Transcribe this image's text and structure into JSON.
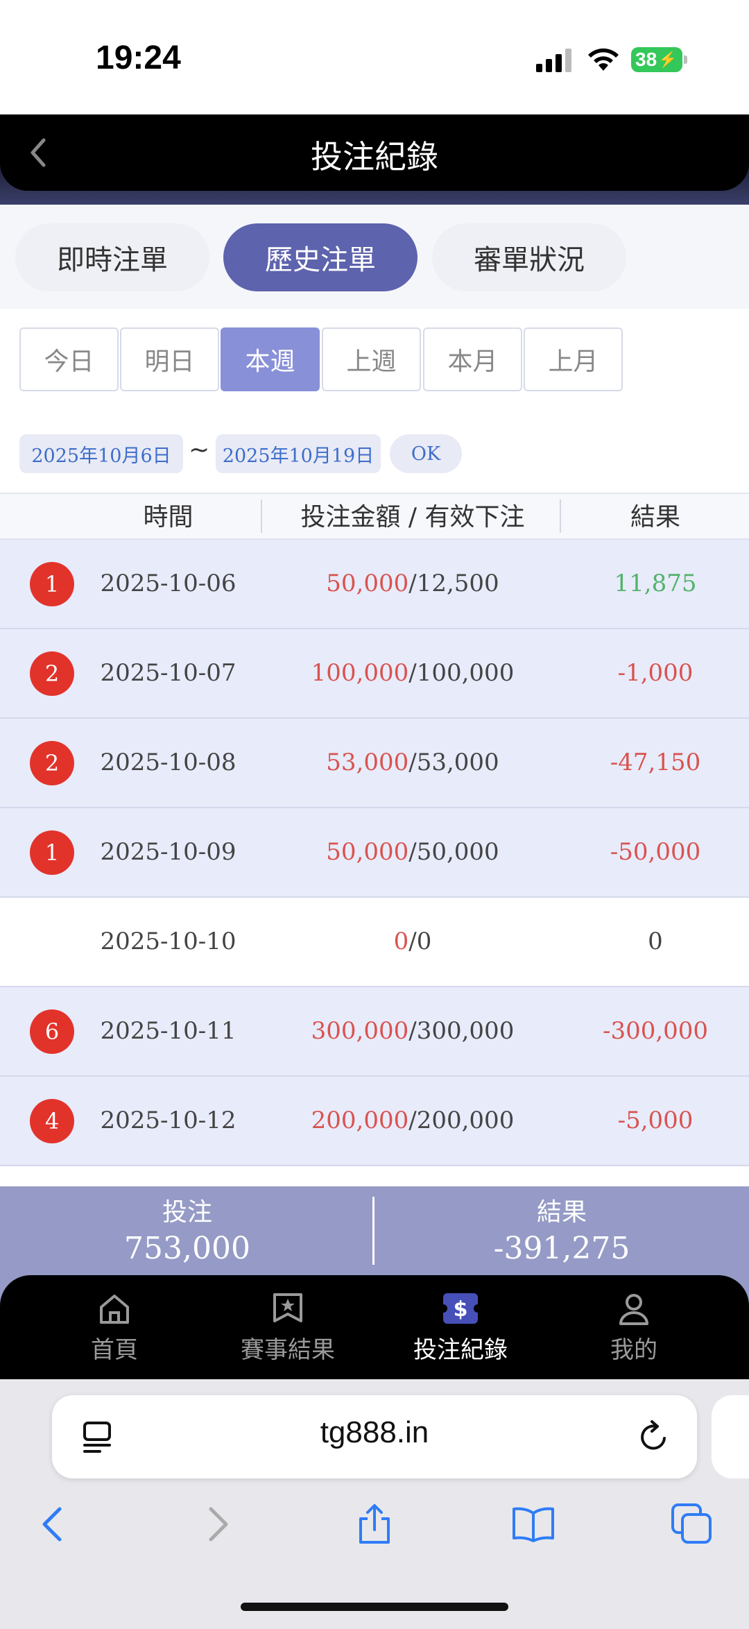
{
  "status_bar": {
    "time": "19:24",
    "battery": "38"
  },
  "header": {
    "title": "投注紀錄"
  },
  "tabs": [
    {
      "label": "即時注單",
      "active": false
    },
    {
      "label": "歷史注單",
      "active": true
    },
    {
      "label": "審單狀況",
      "active": false
    }
  ],
  "periods": [
    {
      "label": "今日",
      "active": false
    },
    {
      "label": "明日",
      "active": false
    },
    {
      "label": "本週",
      "active": true
    },
    {
      "label": "上週",
      "active": false
    },
    {
      "label": "本月",
      "active": false
    },
    {
      "label": "上月",
      "active": false
    }
  ],
  "date_range": {
    "start": "2025年10月6日",
    "separator": "~",
    "end": "2025年10月19日",
    "ok_label": "OK"
  },
  "table": {
    "headers": {
      "time": "時間",
      "amount": "投注金額 / 有效下注",
      "result": "結果"
    },
    "rows": [
      {
        "badge": "1",
        "date": "2025-10-06",
        "bet": "50,000",
        "valid": "/12,500",
        "result": "11,875",
        "result_type": "green"
      },
      {
        "badge": "2",
        "date": "2025-10-07",
        "bet": "100,000",
        "valid": "/100,000",
        "result": "-1,000",
        "result_type": "red"
      },
      {
        "badge": "2",
        "date": "2025-10-08",
        "bet": "53,000",
        "valid": "/53,000",
        "result": "-47,150",
        "result_type": "red"
      },
      {
        "badge": "1",
        "date": "2025-10-09",
        "bet": "50,000",
        "valid": "/50,000",
        "result": "-50,000",
        "result_type": "red"
      },
      {
        "badge": "",
        "date": "2025-10-10",
        "bet": "0",
        "valid": "/0",
        "result": "0",
        "result_type": "gray"
      },
      {
        "badge": "6",
        "date": "2025-10-11",
        "bet": "300,000",
        "valid": "/300,000",
        "result": "-300,000",
        "result_type": "red"
      },
      {
        "badge": "4",
        "date": "2025-10-12",
        "bet": "200,000",
        "valid": "/200,000",
        "result": "-5,000",
        "result_type": "red"
      }
    ]
  },
  "summary": {
    "bet_label": "投注",
    "bet_value": "753,000",
    "result_label": "結果",
    "result_value": "-391,275"
  },
  "bottom_nav": [
    {
      "label": "首頁",
      "icon": "home-icon",
      "active": false
    },
    {
      "label": "賽事結果",
      "icon": "results-icon",
      "active": false
    },
    {
      "label": "投注紀錄",
      "icon": "bet-record-icon",
      "active": true
    },
    {
      "label": "我的",
      "icon": "profile-icon",
      "active": false
    }
  ],
  "browser": {
    "url": "tg888.in"
  },
  "colors": {
    "accent": "#5d63ad",
    "period_active": "#8890d8",
    "loss": "#d9534f",
    "win": "#52b36c",
    "badge": "#e2332b"
  }
}
